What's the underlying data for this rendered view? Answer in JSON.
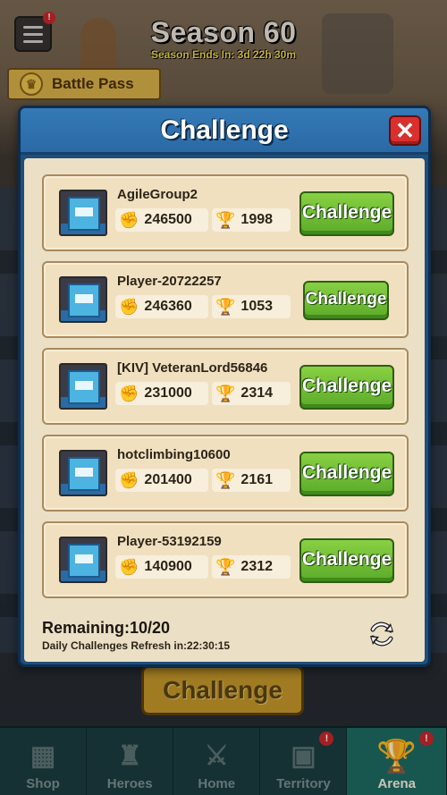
{
  "hud": {
    "season_title": "Season 60",
    "season_ends": "Season Ends In: 3d 22h 30m",
    "menu_badge": "!",
    "battle_pass_label": "Battle Pass"
  },
  "modal": {
    "title": "Challenge",
    "close_label": "✕",
    "opponents": [
      {
        "name": "AgileGroup2",
        "power": "246500",
        "trophies": "1998",
        "button": "Challenge"
      },
      {
        "name": "Player-20722257",
        "power": "246360",
        "trophies": "1053",
        "button": "Challenge"
      },
      {
        "name": "[KIV] VeteranLord56846",
        "power": "231000",
        "trophies": "2314",
        "button": "Challenge"
      },
      {
        "name": "hotclimbing10600",
        "power": "201400",
        "trophies": "2161",
        "button": "Challenge"
      },
      {
        "name": "Player-53192159",
        "power": "140900",
        "trophies": "2312",
        "button": "Challenge"
      }
    ],
    "remaining": "Remaining:10/20",
    "refresh_text": "Daily Challenges Refresh in:22:30:15"
  },
  "background_button": "Challenge",
  "nav": {
    "items": [
      {
        "label": "Shop",
        "icon": "shop-icon",
        "badge": ""
      },
      {
        "label": "Heroes",
        "icon": "heroes-icon",
        "badge": ""
      },
      {
        "label": "Home",
        "icon": "home-swords-icon",
        "badge": ""
      },
      {
        "label": "Territory",
        "icon": "territory-icon",
        "badge": "!"
      },
      {
        "label": "Arena",
        "icon": "arena-trophy-icon",
        "badge": "!"
      }
    ],
    "active": "Arena"
  },
  "colors": {
    "modal_header": "#2a6aa5",
    "challenge_button": "#5cab2a",
    "close_button": "#d8302e",
    "active_nav": "#1e6b62"
  }
}
